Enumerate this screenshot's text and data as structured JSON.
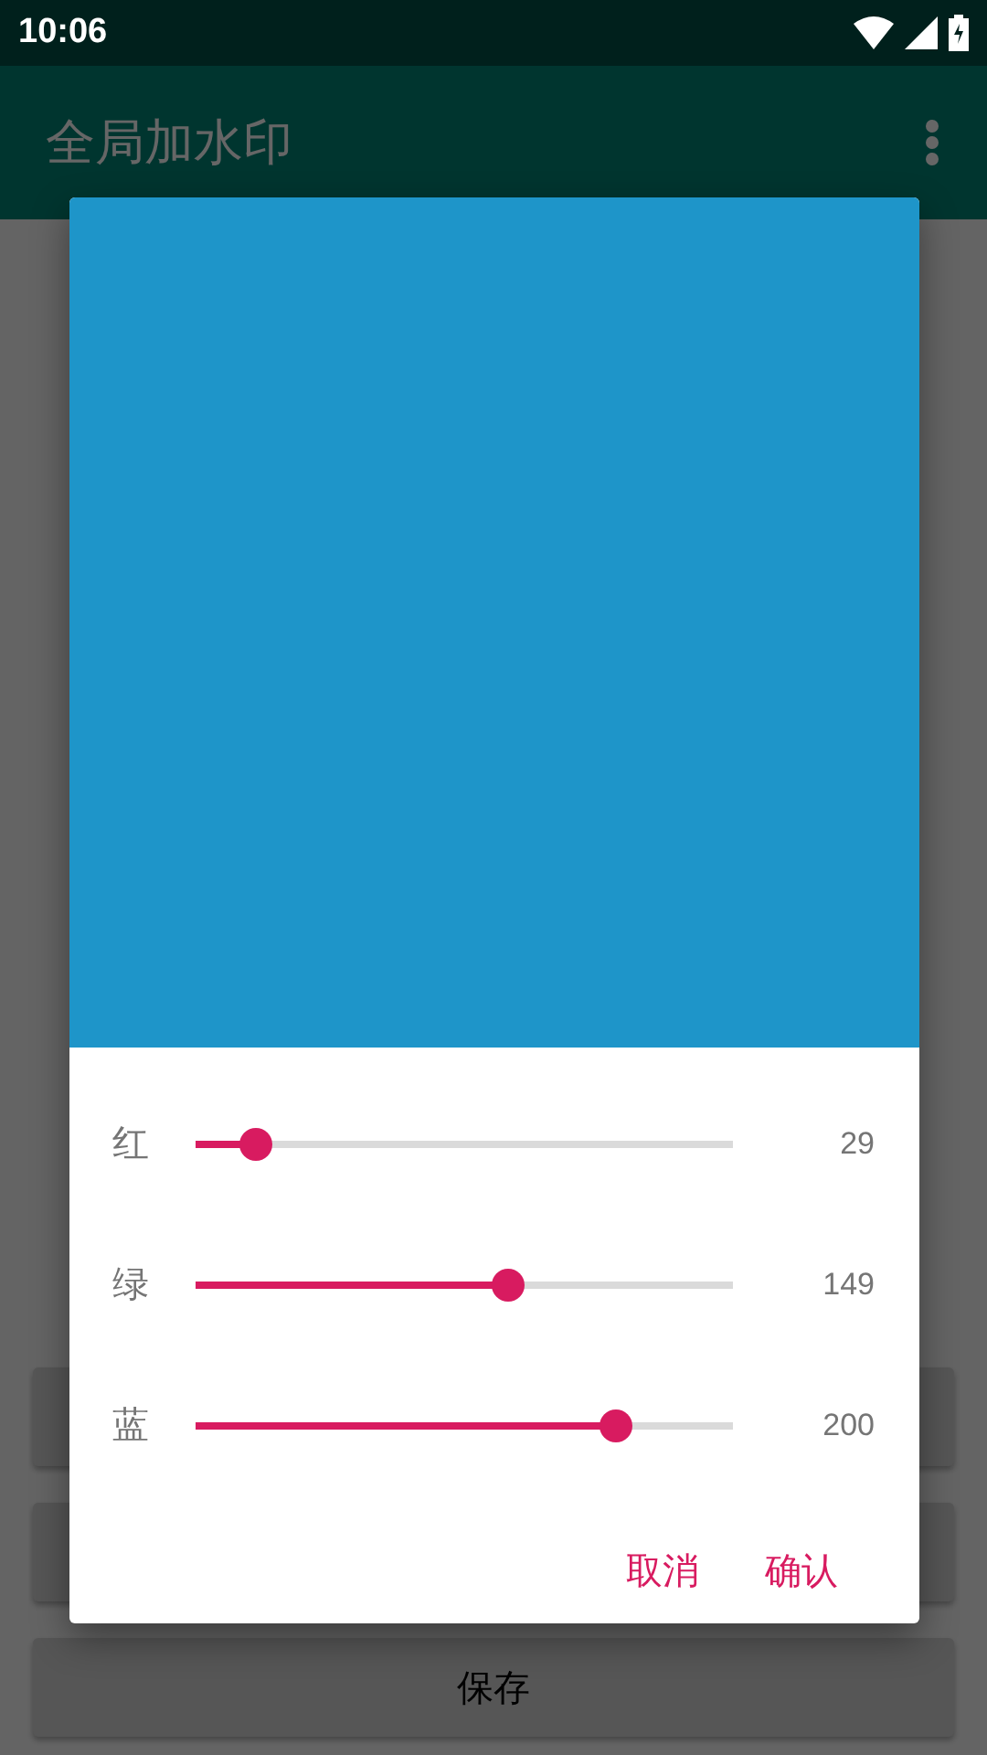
{
  "status_bar": {
    "time": "10:06"
  },
  "app_bar": {
    "title": "全局加水印"
  },
  "page": {
    "buttons": [
      {
        "kind": "hidden"
      },
      {
        "kind": "hidden"
      },
      {
        "kind": "text",
        "label": "保存"
      }
    ]
  },
  "dialog": {
    "channels": [
      {
        "label": "红",
        "level": 0.114,
        "reading": "29"
      },
      {
        "label": "绿",
        "level": 0.584,
        "reading": "149"
      },
      {
        "label": "蓝",
        "level": 0.784,
        "reading": "200"
      }
    ],
    "actions": [
      "取消",
      "确认"
    ]
  }
}
